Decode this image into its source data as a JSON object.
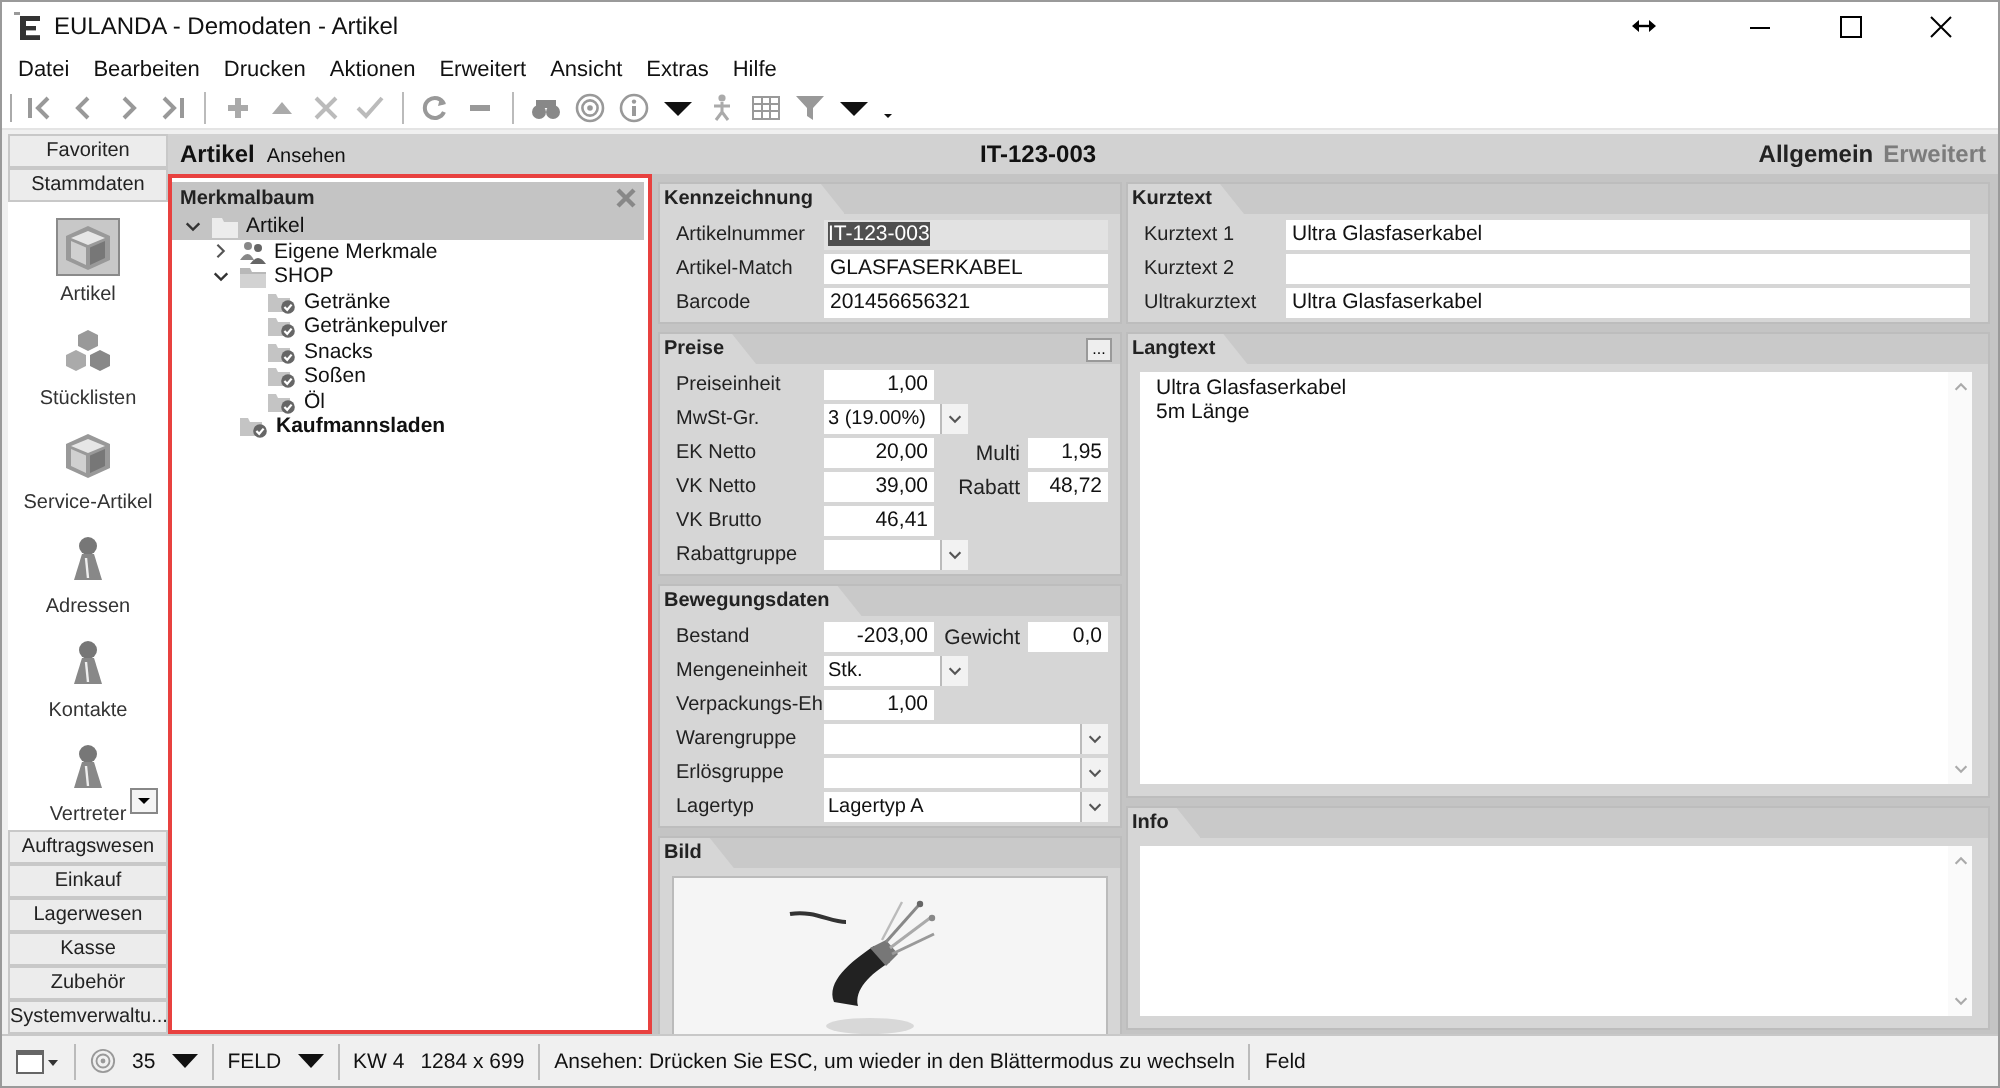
{
  "window": {
    "title": "EULANDA - Demodaten - Artikel"
  },
  "menu": [
    "Datei",
    "Bearbeiten",
    "Drucken",
    "Aktionen",
    "Erweitert",
    "Ansicht",
    "Extras",
    "Hilfe"
  ],
  "toolbar": [
    {
      "kind": "first"
    },
    {
      "kind": "prev"
    },
    {
      "kind": "next"
    },
    {
      "kind": "last"
    },
    {
      "kind": "sep"
    },
    {
      "kind": "add"
    },
    {
      "kind": "up"
    },
    {
      "kind": "delete"
    },
    {
      "kind": "confirm"
    },
    {
      "kind": "sep"
    },
    {
      "kind": "refresh"
    },
    {
      "kind": "minus"
    },
    {
      "kind": "sep"
    },
    {
      "kind": "binoculars"
    },
    {
      "kind": "target"
    },
    {
      "kind": "info"
    },
    {
      "kind": "caret"
    },
    {
      "kind": "figure"
    },
    {
      "kind": "grid"
    },
    {
      "kind": "filter"
    },
    {
      "kind": "caret"
    },
    {
      "kind": "more"
    }
  ],
  "sidebar": {
    "top_sections": [
      "Favoriten",
      "Stammdaten"
    ],
    "items": [
      {
        "label": "Artikel",
        "kind": "cube",
        "selected": true
      },
      {
        "label": "Stücklisten",
        "kind": "cubes",
        "selected": false
      },
      {
        "label": "Service-Artikel",
        "kind": "cube",
        "selected": false
      },
      {
        "label": "Adressen",
        "kind": "pawn",
        "selected": false
      },
      {
        "label": "Kontakte",
        "kind": "pawn",
        "selected": false
      },
      {
        "label": "Vertreter",
        "kind": "pawn",
        "selected": false
      }
    ],
    "bottom_sections": [
      "Auftragswesen",
      "Einkauf",
      "Lagerwesen",
      "Kasse",
      "Zubehör",
      "Systemverwaltu..."
    ]
  },
  "header": {
    "module": "Artikel",
    "mode": "Ansehen",
    "record": "IT-123-003",
    "views": [
      {
        "label": "Allgemein",
        "selected": true
      },
      {
        "label": "Erweitert",
        "selected": false
      }
    ]
  },
  "tree_panel": {
    "title": "Merkmalbaum",
    "highlighted": true,
    "nodes": [
      {
        "label": "Artikel",
        "kind": "root",
        "selected": true,
        "bold": false,
        "expanded": true,
        "children": [
          {
            "label": "Eigene Merkmale",
            "kind": "group",
            "selected": false,
            "bold": false,
            "expanded": false
          },
          {
            "label": "SHOP",
            "kind": "folder",
            "selected": false,
            "bold": false,
            "expanded": true,
            "children": [
              {
                "label": "Getränke",
                "kind": "tagged-folder",
                "selected": false,
                "bold": false
              },
              {
                "label": "Getränkepulver",
                "kind": "tagged-folder",
                "selected": false,
                "bold": false
              },
              {
                "label": "Snacks",
                "kind": "tagged-folder",
                "selected": false,
                "bold": false
              },
              {
                "label": "Soßen",
                "kind": "tagged-folder",
                "selected": false,
                "bold": false
              },
              {
                "label": "Öl",
                "kind": "tagged-folder",
                "selected": false,
                "bold": false
              }
            ]
          },
          {
            "label": "Kaufmannsladen",
            "kind": "tagged-folder",
            "selected": false,
            "bold": true
          }
        ]
      }
    ]
  },
  "left_groups": [
    {
      "title": "Kennzeichnung",
      "kind": "fields",
      "fields": [
        {
          "label": "Artikelnummer",
          "kind": "readonly",
          "value": "IT-123-003"
        },
        {
          "label": "Artikel-Match",
          "kind": "text",
          "value": "GLASFASERKABEL"
        },
        {
          "label": "Barcode",
          "kind": "text",
          "value": "201456656321"
        }
      ]
    },
    {
      "title": "Preise",
      "kind": "fields",
      "action_button": "...",
      "fields": [
        {
          "label": "Preiseinheit",
          "kind": "number",
          "value": "1,00"
        },
        {
          "label": "MwSt-Gr.",
          "kind": "combo",
          "value": "3 (19.00%)"
        },
        {
          "label": "EK Netto",
          "kind": "number",
          "value": "20,00",
          "pair": {
            "label": "Multi",
            "value": "1,95"
          }
        },
        {
          "label": "VK Netto",
          "kind": "number",
          "value": "39,00",
          "pair": {
            "label": "Rabatt",
            "value": "48,72"
          }
        },
        {
          "label": "VK Brutto",
          "kind": "number",
          "value": "46,41"
        },
        {
          "label": "Rabattgruppe",
          "kind": "combo"
        }
      ]
    },
    {
      "title": "Bewegungsdaten",
      "kind": "fields",
      "fields": [
        {
          "label": "Bestand",
          "kind": "number",
          "value": "-203,00",
          "pair": {
            "label": "Gewicht",
            "value": "0,0"
          }
        },
        {
          "label": "Mengeneinheit",
          "kind": "combo",
          "value": "Stk."
        },
        {
          "label": "Verpackungs-Eh",
          "kind": "number",
          "value": "1,00"
        },
        {
          "label": "Warengruppe",
          "kind": "wide-combo"
        },
        {
          "label": "Erlösgruppe",
          "kind": "wide-combo"
        },
        {
          "label": "Lagertyp",
          "kind": "wide-combo",
          "value": "Lagertyp A"
        }
      ]
    },
    {
      "title": "Bild",
      "kind": "picture"
    }
  ],
  "right_groups": [
    {
      "title": "Kurztext",
      "kind": "fields",
      "fields": [
        {
          "label": "Kurztext 1",
          "kind": "text",
          "value": "Ultra Glasfaserkabel"
        },
        {
          "label": "Kurztext 2",
          "kind": "text"
        },
        {
          "label": "Ultrakurztext",
          "kind": "text",
          "value": "Ultra Glasfaserkabel"
        }
      ]
    },
    {
      "title": "Langtext",
      "kind": "memo",
      "lines": [
        "Ultra Glasfaserkabel",
        "5m Länge"
      ]
    },
    {
      "title": "Info",
      "kind": "memo"
    }
  ],
  "status_bar": [
    {
      "kind": "window-menu"
    },
    {
      "kind": "zoom",
      "texts": [
        "35"
      ]
    },
    {
      "kind": "dropdown",
      "texts": [
        "FELD"
      ]
    },
    {
      "kind": "text",
      "texts": [
        "KW 4",
        "1284 x 699"
      ]
    },
    {
      "kind": "text",
      "texts": [
        "Ansehen: Drücken Sie ESC, um wieder in den Blättermodus zu wechseln"
      ]
    },
    {
      "kind": "text",
      "texts": [
        "Feld"
      ]
    }
  ]
}
